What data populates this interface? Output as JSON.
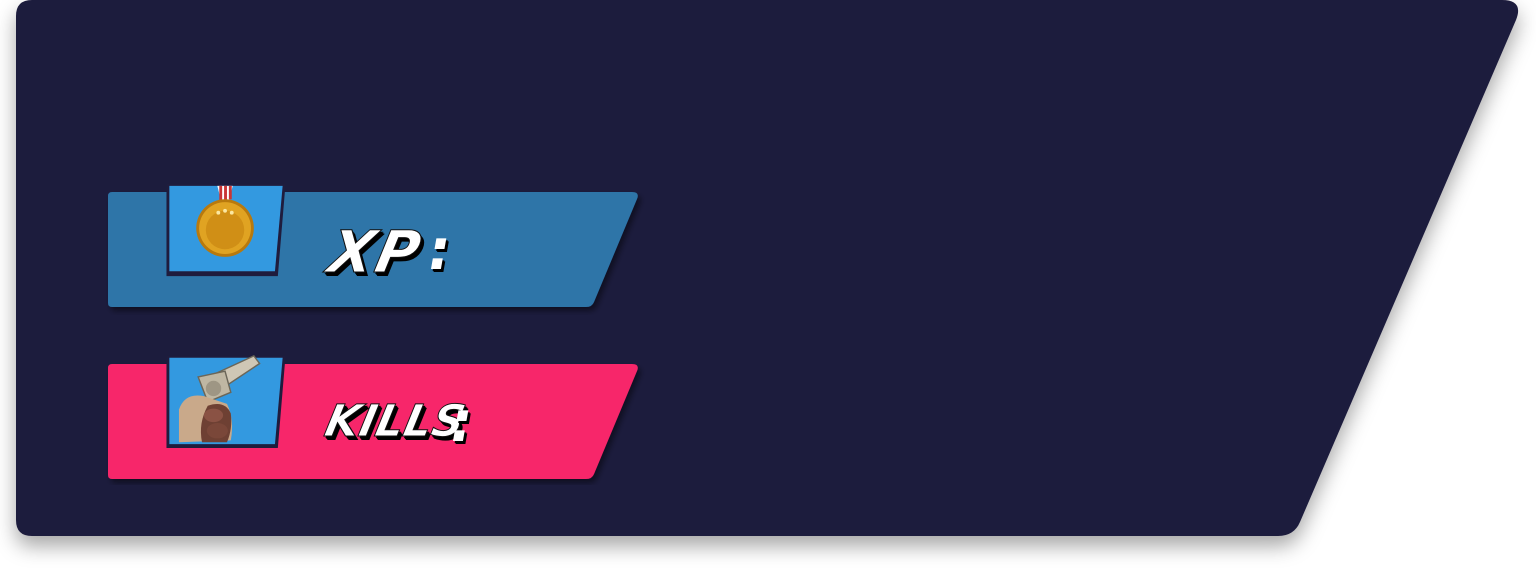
{
  "panel": {
    "background_color": "#1f1c3d"
  },
  "stats": {
    "xp": {
      "label": "XP",
      "colon": ":",
      "value": "",
      "bar_color": "#2e74a8",
      "icon": "gold-medal-icon",
      "icon_bg_color": "#3399e0"
    },
    "kills": {
      "label": "KILLS",
      "colon": ":",
      "value": "",
      "bar_color": "#f7256a",
      "icon": "revolver-icon",
      "icon_bg_color": "#3399e0"
    }
  }
}
